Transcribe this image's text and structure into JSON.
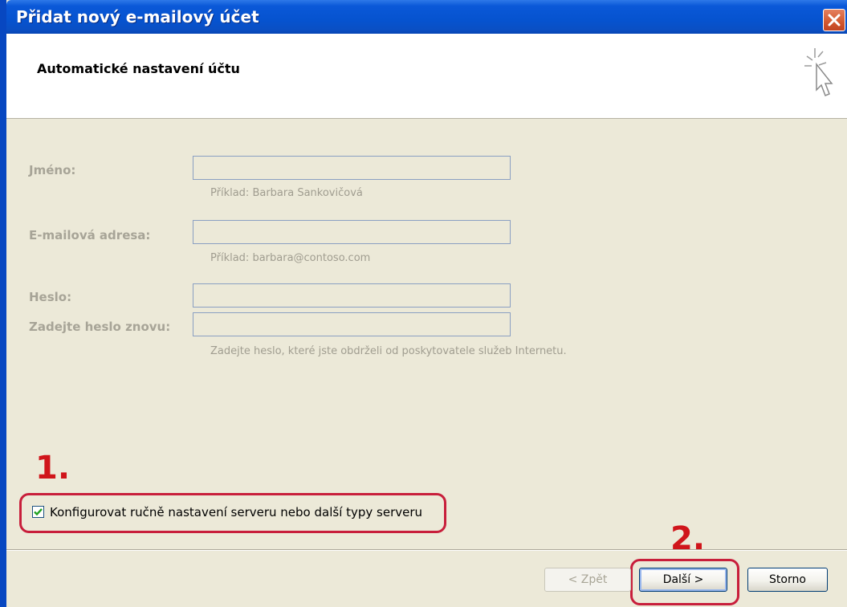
{
  "window": {
    "title": "Přidat nový e-mailový účet"
  },
  "header": {
    "title": "Automatické nastavení účtu"
  },
  "form": {
    "name_label": "Jméno:",
    "name_value": "",
    "name_hint": "Příklad: Barbara Sankovičová",
    "email_label": "E-mailová adresa:",
    "email_value": "",
    "email_hint": "Příklad: barbara@contoso.com",
    "password_label": "Heslo:",
    "password_value": "",
    "password_repeat_label": "Zadejte heslo znovu:",
    "password_repeat_value": "",
    "password_hint": "Zadejte heslo, které jste obdrželi od poskytovatele služeb Internetu."
  },
  "annotations": {
    "step1": "1.",
    "step2": "2."
  },
  "manual_config": {
    "label": "Konfigurovat ručně nastavení serveru nebo další typy serveru",
    "checked": true
  },
  "buttons": {
    "back": "< Zpět",
    "next": "Další >",
    "cancel": "Storno"
  },
  "colors": {
    "title_bar": "#0a58d8",
    "annotation": "#c81e3b"
  }
}
